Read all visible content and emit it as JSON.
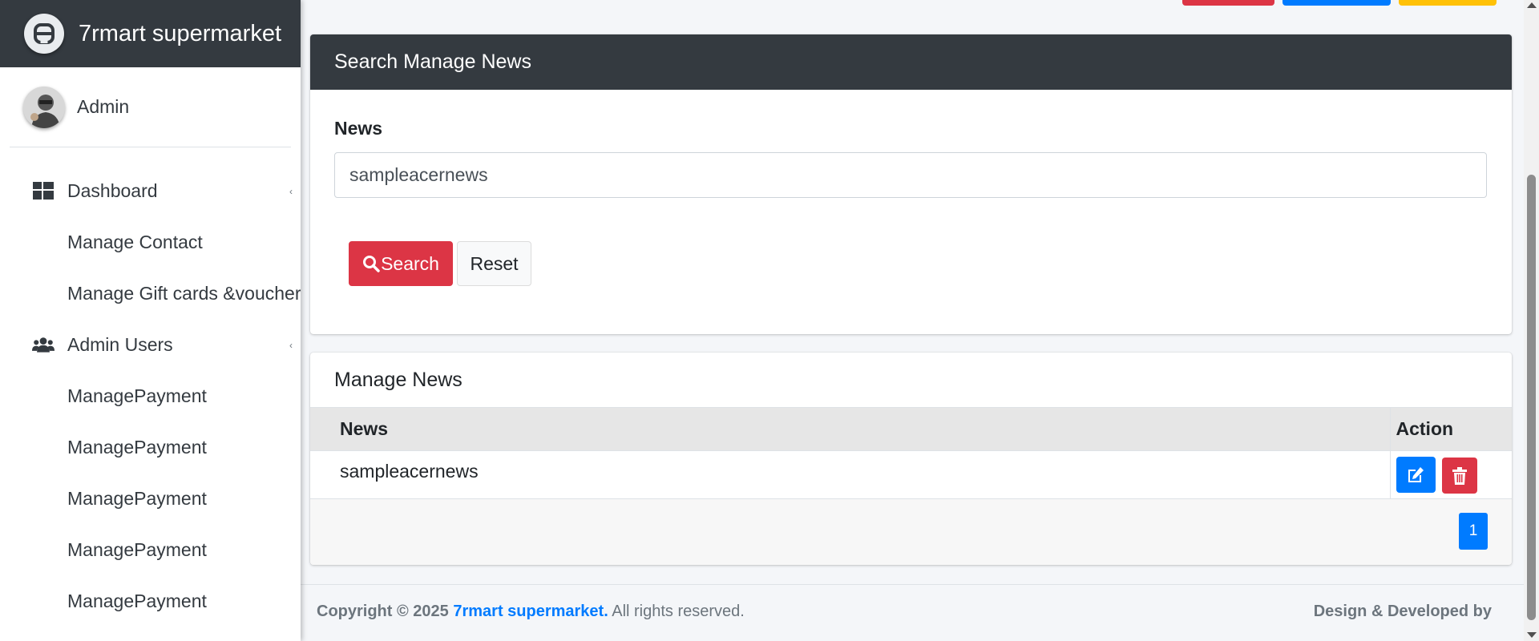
{
  "brand": {
    "name": "7rmart supermarket",
    "logo_icon": "brand-logo-icon"
  },
  "user": {
    "name": "Admin"
  },
  "sidebar": {
    "items": [
      {
        "label": "Dashboard",
        "icon": "dashboard-icon"
      },
      {
        "label": "Manage Contact"
      },
      {
        "label": "Manage Gift cards &voucher"
      },
      {
        "label": "Admin Users",
        "icon": "users-icon"
      },
      {
        "label": "ManagePayment"
      },
      {
        "label": "ManagePayment"
      },
      {
        "label": "ManagePayment"
      },
      {
        "label": "ManagePayment"
      },
      {
        "label": "ManagePayment"
      }
    ]
  },
  "search_card": {
    "title": "Search Manage News",
    "field_label": "News",
    "field_value": "sampleacernews",
    "search_button": "Search",
    "reset_button": "Reset"
  },
  "list_card": {
    "title": "Manage News",
    "columns": [
      "News",
      "Action"
    ],
    "rows": [
      {
        "news": "sampleacernews"
      }
    ],
    "current_page": "1"
  },
  "footer": {
    "copyright_prefix": "Copyright © 2025",
    "brand_link": "7rmart supermarket.",
    "rights": "All rights reserved.",
    "right_text": "Design & Developed by"
  },
  "colors": {
    "sidebar_header": "#343a40",
    "danger": "#dc3545",
    "primary": "#007bff",
    "warning": "#ffc107"
  }
}
